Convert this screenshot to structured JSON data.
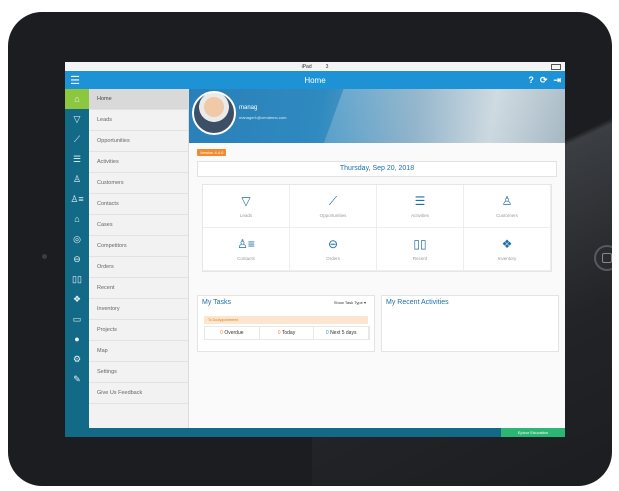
{
  "status_bar": {
    "device": "iPad",
    "time": "3"
  },
  "header": {
    "title": "Home"
  },
  "sidebar": {
    "items": [
      {
        "label": "Home",
        "icon": "home-icon",
        "active": true
      },
      {
        "label": "Leads",
        "icon": "funnel-icon"
      },
      {
        "label": "Opportunities",
        "icon": "trend-icon"
      },
      {
        "label": "Activities",
        "icon": "list-icon"
      },
      {
        "label": "Customers",
        "icon": "person-icon"
      },
      {
        "label": "Contacts",
        "icon": "contacts-icon"
      },
      {
        "label": "Cases",
        "icon": "case-icon"
      },
      {
        "label": "Competitors",
        "icon": "target-icon"
      },
      {
        "label": "Orders",
        "icon": "basket-icon"
      },
      {
        "label": "Recent",
        "icon": "book-icon"
      },
      {
        "label": "Inventory",
        "icon": "boxes-icon"
      },
      {
        "label": "Projects",
        "icon": "folder-icon"
      },
      {
        "label": "Map",
        "icon": "map-pin-icon"
      },
      {
        "label": "Settings",
        "icon": "gear-icon"
      },
      {
        "label": "Give Us Feedback",
        "icon": "feedback-icon"
      }
    ]
  },
  "profile": {
    "name": "manag",
    "email": "manager1@crmdemo.com"
  },
  "version_badge": "Version 4.4.0",
  "date": "Thursday, Sep 20, 2018",
  "tiles": [
    {
      "label": "Leads",
      "icon": "funnel-icon"
    },
    {
      "label": "Opportunities",
      "icon": "trend-icon"
    },
    {
      "label": "Activities",
      "icon": "list-icon"
    },
    {
      "label": "Customers",
      "icon": "person-icon"
    },
    {
      "label": "Contacts",
      "icon": "contacts-icon"
    },
    {
      "label": "Orders",
      "icon": "basket-icon"
    },
    {
      "label": "Recent",
      "icon": "book-icon"
    },
    {
      "label": "Inventory",
      "icon": "boxes-icon"
    }
  ],
  "tasks": {
    "title": "My Tasks",
    "filter": "Show Task Type ▾",
    "subheading": "To Do/Appointment",
    "overdue": {
      "count": "0",
      "label": "Overdue"
    },
    "today": {
      "count": "0",
      "label": "Today"
    },
    "next": {
      "count": "0",
      "label": "Next 5 days"
    }
  },
  "recent": {
    "title": "My Recent Activities"
  },
  "footer": {
    "label": "Epicor Education"
  },
  "colors": {
    "header_blue": "#1d93d6",
    "rail": "#136a87",
    "active_green": "#8dc63f",
    "orange": "#f08b2e",
    "green_button": "#2bb673"
  }
}
